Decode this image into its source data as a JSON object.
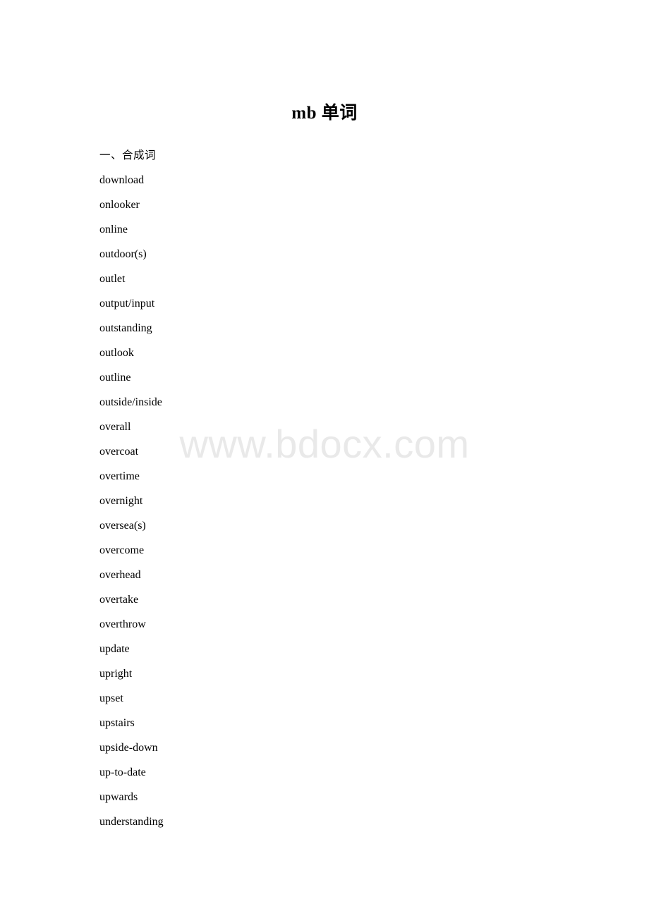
{
  "document": {
    "title": "mb 单词",
    "watermark": "www.bdocx.com",
    "sections": [
      {
        "heading": "一、合成词",
        "words": [
          "download",
          "onlooker",
          "online",
          "outdoor(s)",
          "outlet",
          "output/input",
          "outstanding",
          "outlook",
          "outline",
          "outside/inside",
          "overall",
          "overcoat",
          "overtime",
          "overnight",
          "oversea(s)",
          "overcome",
          "overhead",
          "overtake",
          "overthrow",
          "update",
          "upright",
          "upset",
          "upstairs",
          "upside-down",
          "up-to-date",
          "upwards",
          "understanding"
        ]
      }
    ],
    "colors": {
      "page_background": "#ffffff",
      "text": "#000000",
      "watermark": "#e9e9e9"
    }
  }
}
